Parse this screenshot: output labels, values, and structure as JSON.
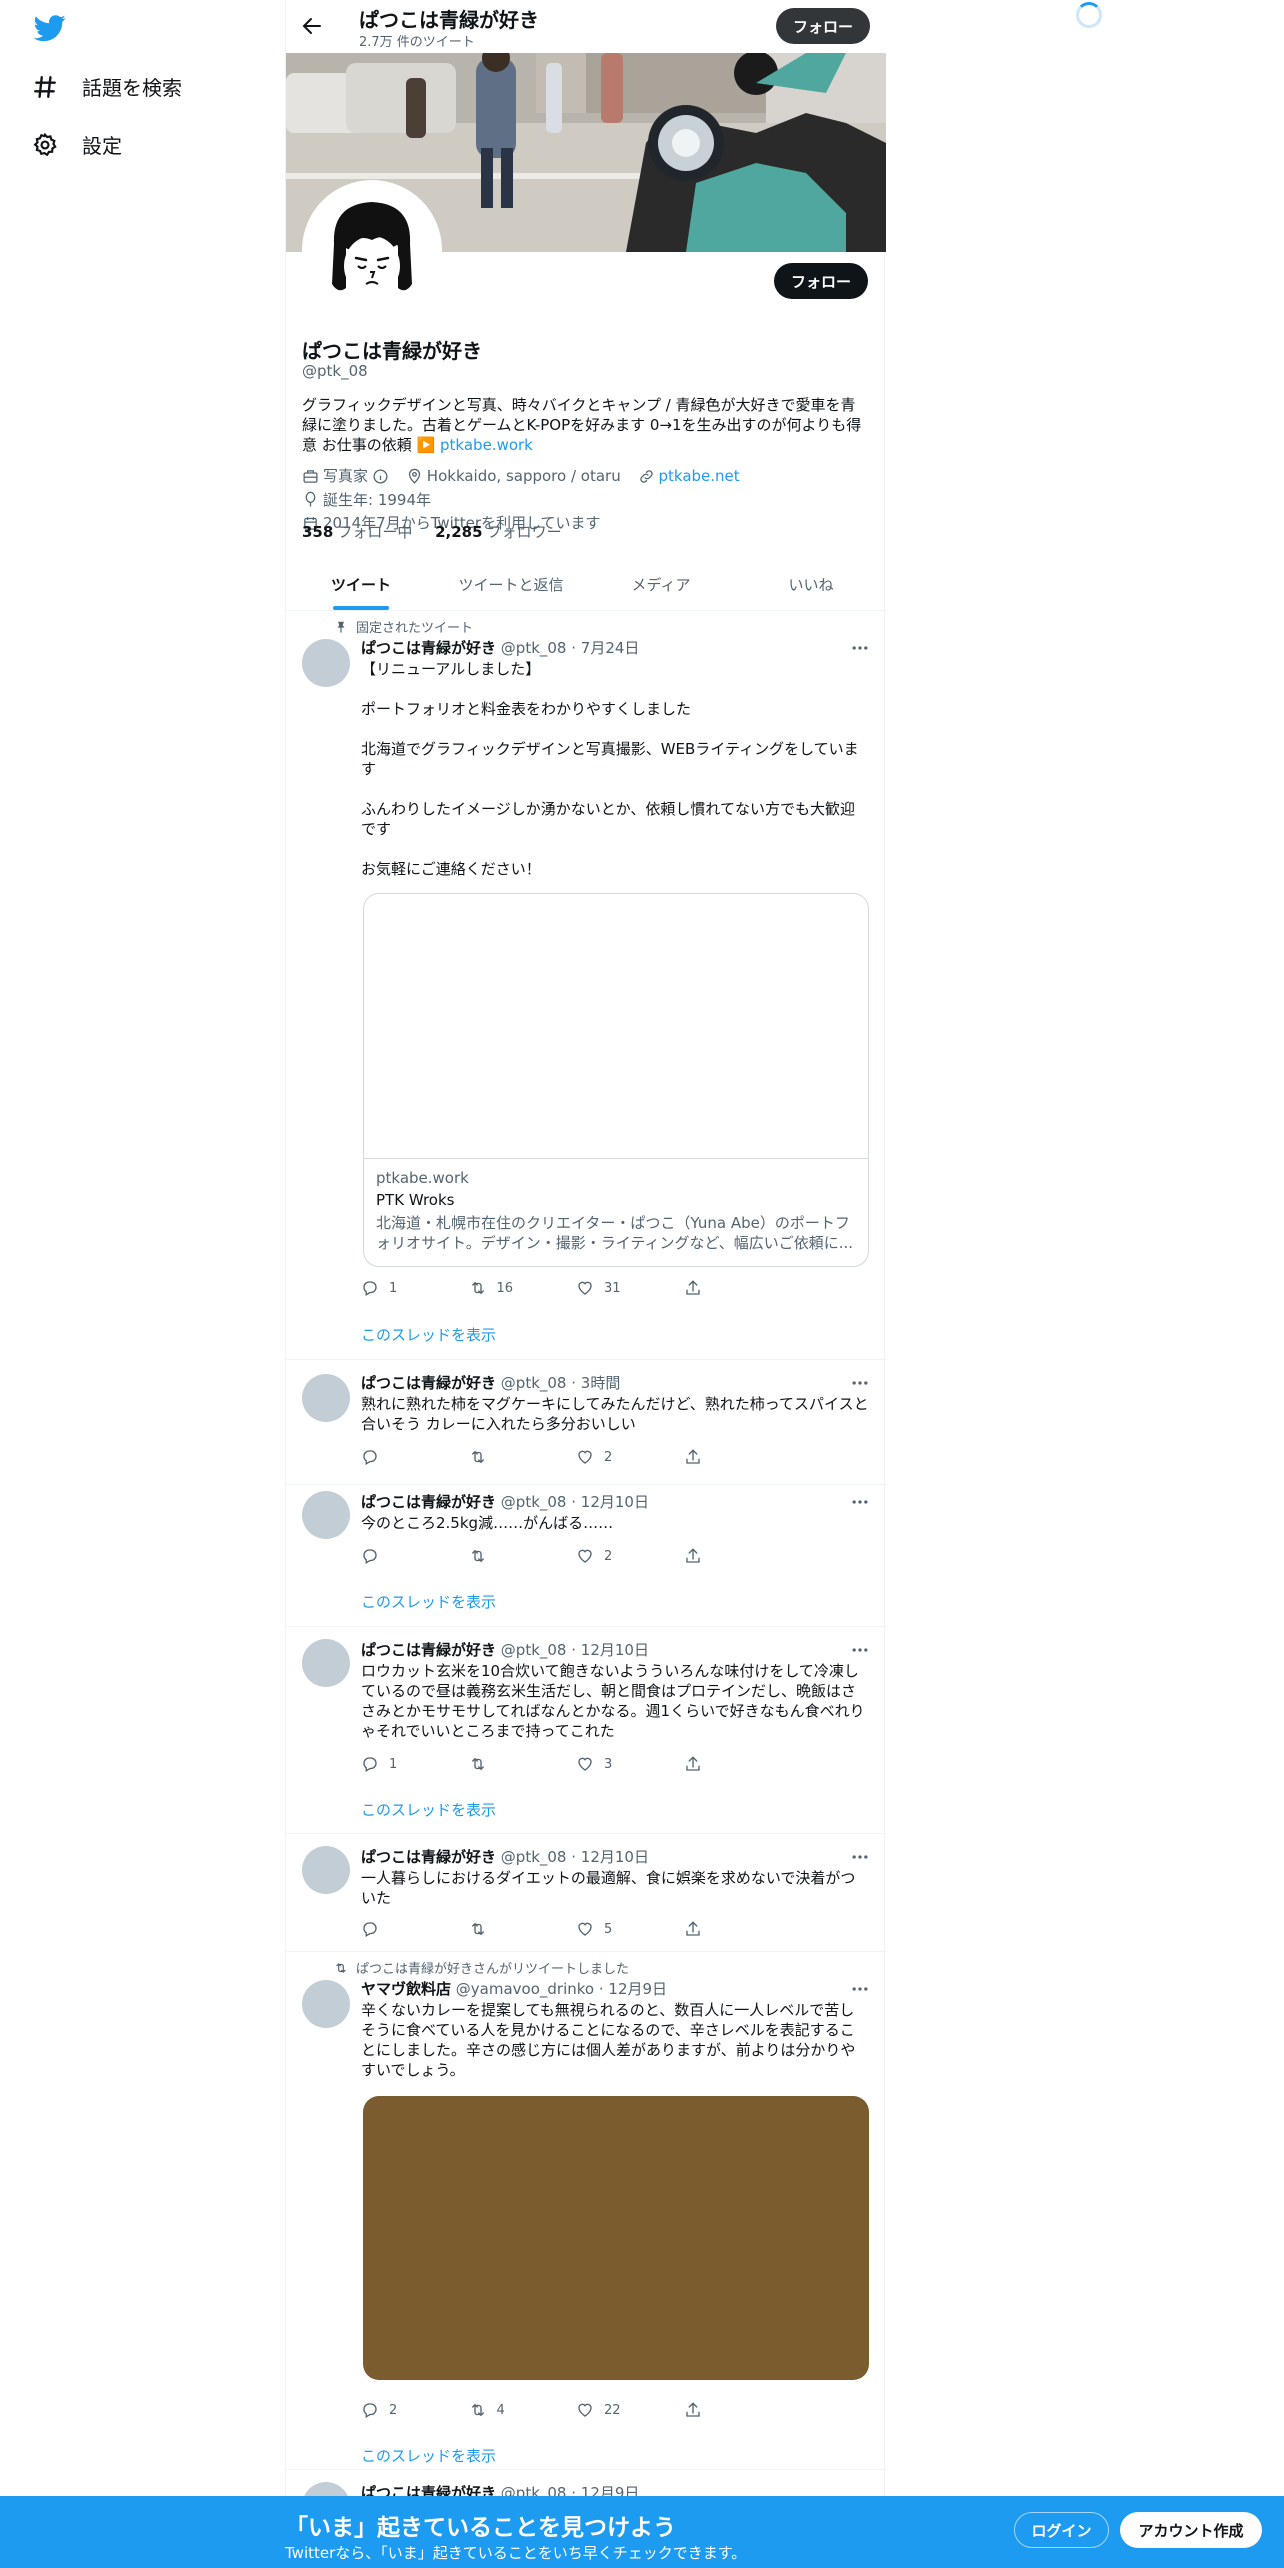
{
  "nav": {
    "explore_label": "話題を検索",
    "settings_label": "設定"
  },
  "header": {
    "title": "ぱつこは青緑が好き",
    "subtitle": "2.7万 件のツイート",
    "follow_label": "フォロー"
  },
  "profile": {
    "name": "ぱつこは青緑が好き",
    "handle": "@ptk_08",
    "follow_label": "フォロー",
    "bio": "グラフィックデザインと写真、時々バイクとキャンプ / 青緑色が大好きで愛車を青緑に塗りました。古着とゲームとK-POPを好みます 0→1を生み出すのが何よりも得意 お仕事の依頼",
    "bio_emoji": "▶️",
    "bio_link": "ptkabe.work",
    "category": "写真家",
    "location": "Hokkaido, sapporo / otaru",
    "website": "ptkabe.net",
    "birthday": "誕生年: 1994年",
    "joined": "2014年7月からTwitterを利用しています",
    "following_count": "358",
    "following_label": "フォロー中",
    "followers_count": "2,285",
    "followers_label": "フォロワー"
  },
  "tabs": [
    "ツイート",
    "ツイートと返信",
    "メディア",
    "いいね"
  ],
  "tweets": [
    {
      "context": "固定されたツイート",
      "name": "ぱつこは青緑が好き",
      "meta": "@ptk_08 · 7月24日",
      "text": "【リニューアルしました】\n\nポートフォリオと料金表をわかりやすくしました\n\n北海道でグラフィックデザインと写真撮影、WEBライティングをしています\n\nふんわりしたイメージしか湧かないとか、依頼し慣れてない方でも大歓迎です\n\nお気軽にご連絡ください！",
      "card": {
        "domain": "ptkabe.work",
        "title": "PTK Wroks",
        "desc": "北海道・札幌市在住のクリエイター・ぱつこ（Yuna Abe）のポートフォリオサイト。デザイン・撮影・ライティングなど、幅広いご依頼に..."
      },
      "reply": "1",
      "retweet": "16",
      "like": "31",
      "thread": "このスレッドを表示"
    },
    {
      "name": "ぱつこは青緑が好き",
      "meta": "@ptk_08 · 3時間",
      "text": "熟れに熟れた柿をマグケーキにしてみたんだけど、熟れた柿ってスパイスと合いそう カレーに入れたら多分おいしい",
      "reply": "",
      "retweet": "",
      "like": "2"
    },
    {
      "name": "ぱつこは青緑が好き",
      "meta": "@ptk_08 · 12月10日",
      "text": "今のところ2.5kg減……がんばる……",
      "reply": "",
      "retweet": "",
      "like": "2",
      "thread": "このスレッドを表示"
    },
    {
      "name": "ぱつこは青緑が好き",
      "meta": "@ptk_08 · 12月10日",
      "text": "ロウカット玄米を10合炊いて飽きないようういろんな味付けをして冷凍しているので昼は義務玄米生活だし、朝と間食はプロテインだし、晩飯はささみとかモサモサしてればなんとかなる。週1くらいで好きなもん食べれりゃそれでいいところまで持ってこれた",
      "reply": "1",
      "retweet": "",
      "like": "3",
      "thread": "このスレッドを表示"
    },
    {
      "name": "ぱつこは青緑が好き",
      "meta": "@ptk_08 · 12月10日",
      "text": "一人暮らしにおけるダイエットの最適解、食に娯楽を求めないで決着がついた",
      "reply": "",
      "retweet": "",
      "like": "5"
    },
    {
      "context": "ぱつこは青緑が好きさんがリツイートしました",
      "name": "ヤマヴ飲料店",
      "meta": "@yamavoo_drinko · 12月9日",
      "text": "辛くないカレーを提案しても無視られるのと、数百人に一人レベルで苦しそうに食べている人を見かけることになるので、辛さレベルを表記することにしました。辛さの感じ方には個人差がありますが、前よりは分かりやすいでしょう。",
      "reply": "2",
      "retweet": "4",
      "like": "22",
      "thread": "このスレッドを表示"
    },
    {
      "name": "ぱつこは青緑が好き",
      "meta": "@ptk_08 · 12月9日"
    }
  ],
  "bottom_bar": {
    "title": "「いま」起きていることを見つけよう",
    "subtitle": "Twitterなら、「いま」起きていることをいち早くチェックできます。",
    "login_label": "ログイン",
    "signup_label": "アカウント作成"
  },
  "colors": {
    "accent": "#1d9bf0",
    "text": "#0f1419",
    "muted": "#536471",
    "media_placeholder": "#7a5c2f"
  }
}
